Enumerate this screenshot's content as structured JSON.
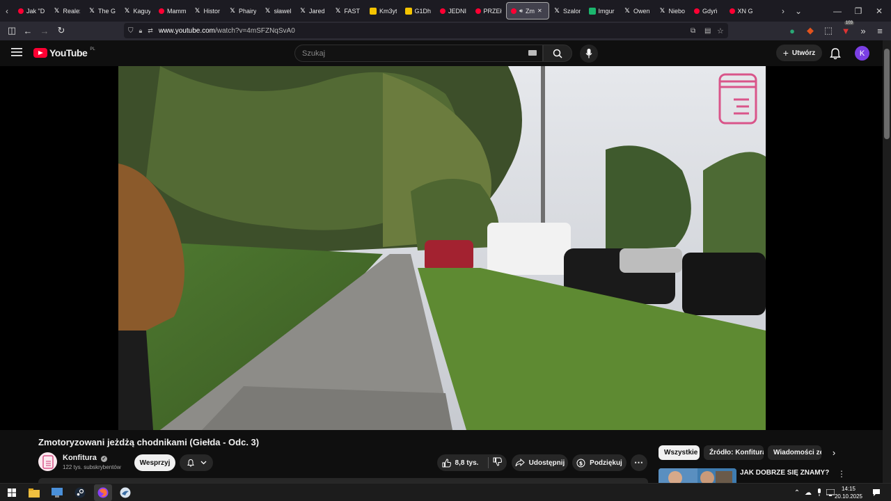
{
  "browser": {
    "tabs": [
      {
        "label": "Jak \"D",
        "favicon": "youtube-icon"
      },
      {
        "label": "Realex",
        "favicon": "x-icon"
      },
      {
        "label": "The Gr",
        "favicon": "x-icon"
      },
      {
        "label": "Kaguy",
        "favicon": "x-icon"
      },
      {
        "label": "Mamm",
        "favicon": "youtube-icon"
      },
      {
        "label": "Histor",
        "favicon": "x-icon"
      },
      {
        "label": "Phairy",
        "favicon": "x-icon"
      },
      {
        "label": "sławek",
        "favicon": "x-icon"
      },
      {
        "label": "Jared",
        "favicon": "x-icon"
      },
      {
        "label": "FAST I",
        "favicon": "x-icon"
      },
      {
        "label": "Km3yt",
        "favicon": "g1-icon"
      },
      {
        "label": "G1Dh",
        "favicon": "g1-icon"
      },
      {
        "label": "JEDNI",
        "favicon": "youtube-icon"
      },
      {
        "label": "PRZEł",
        "favicon": "youtube-icon"
      },
      {
        "label": "Zm",
        "favicon": "youtube-icon",
        "active": true
      },
      {
        "label": "Szalon",
        "favicon": "x-icon"
      },
      {
        "label": "Imgur",
        "favicon": "imgur-icon"
      },
      {
        "label": "Owen",
        "favicon": "x-icon"
      },
      {
        "label": "Niebo",
        "favicon": "x-icon"
      },
      {
        "label": "Gdyń",
        "favicon": "youtube-icon"
      },
      {
        "label": "XN G",
        "favicon": "youtube-icon"
      }
    ],
    "url_host": "www.youtube.com",
    "url_path": "/watch?v=4mSFZNqSvA0",
    "extension_badge": "103"
  },
  "youtube": {
    "logo_text": "YouTube",
    "country_code": "PL",
    "search_placeholder": "Szukaj",
    "create_label": "Utwórz",
    "avatar_letter": "K"
  },
  "video": {
    "title": "Zmotoryzowani jeżdżą chodnikami (Giełda - Odc. 3)",
    "channel_name": "Konfitura",
    "subscribers": "122 tys. subskrybentów",
    "support_label": "Wesprzyj",
    "likes": "8,8 tys.",
    "share_label": "Udostępnij",
    "thanks_label": "Podziękuj"
  },
  "chips": [
    "Wszystkie",
    "Źródło: Konfitura",
    "Wiadomości ze"
  ],
  "recommendation": {
    "title": "JAK DOBRZE SIĘ ZNAMY?"
  },
  "taskbar": {
    "time": "14:15",
    "date": "20.10.2025"
  },
  "colors": {
    "youtube_red": "#ff0033",
    "avatar_purple": "#7b3fe4",
    "channel_logo_pink": "#d9558a"
  }
}
